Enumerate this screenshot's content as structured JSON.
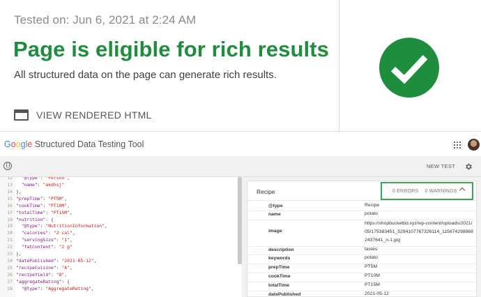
{
  "rich_results": {
    "tested_on": "Tested on: Jun 6, 2021 at 2:24 AM",
    "title": "Page is eligible for rich results",
    "subtitle": "All structured data on the page can generate rich results.",
    "view_rendered_html": "VIEW RENDERED HTML",
    "status_color": "#1e8e3e",
    "status_icon": "check-circle-icon"
  },
  "tool": {
    "google": [
      "G",
      "o",
      "o",
      "g",
      "l",
      "e"
    ],
    "name": "Structured Data Testing Tool",
    "new_test": "NEW TEST"
  },
  "code_lines": [
    {
      "n": "12",
      "t": [
        [
          "p",
          "  \""
        ],
        [
          "k",
          "@type"
        ],
        [
          "p",
          "\": "
        ],
        [
          "s",
          "\"Person\""
        ],
        [
          "p",
          ","
        ]
      ]
    },
    {
      "n": "13",
      "t": [
        [
          "p",
          "  \""
        ],
        [
          "k",
          "name"
        ],
        [
          "p",
          "\": "
        ],
        [
          "s",
          "\"akdhsj\""
        ]
      ]
    },
    {
      "n": "14",
      "t": [
        [
          "p",
          "},"
        ]
      ]
    },
    {
      "n": "15",
      "t": [
        [
          "p",
          "\""
        ],
        [
          "k",
          "prepTime"
        ],
        [
          "p",
          "\": "
        ],
        [
          "s",
          "\"PT5M\""
        ],
        [
          "p",
          ","
        ]
      ]
    },
    {
      "n": "16",
      "t": [
        [
          "p",
          "\""
        ],
        [
          "k",
          "cookTime"
        ],
        [
          "p",
          "\": "
        ],
        [
          "s",
          "\"PT10M\""
        ],
        [
          "p",
          ","
        ]
      ]
    },
    {
      "n": "17",
      "t": [
        [
          "p",
          "\""
        ],
        [
          "k",
          "totalTime"
        ],
        [
          "p",
          "\": "
        ],
        [
          "s",
          "\"PT15M\""
        ],
        [
          "p",
          ","
        ]
      ]
    },
    {
      "n": "18",
      "t": [
        [
          "p",
          "\""
        ],
        [
          "k",
          "nutrition"
        ],
        [
          "p",
          "\": {"
        ]
      ]
    },
    {
      "n": "19",
      "t": [
        [
          "p",
          "  \""
        ],
        [
          "k",
          "@type"
        ],
        [
          "p",
          "\": "
        ],
        [
          "s",
          "\"NutritionInformation\""
        ],
        [
          "p",
          ","
        ]
      ]
    },
    {
      "n": "20",
      "t": [
        [
          "p",
          "  \""
        ],
        [
          "k",
          "calories"
        ],
        [
          "p",
          "\": "
        ],
        [
          "s",
          "\"2 cal\""
        ],
        [
          "p",
          ","
        ]
      ]
    },
    {
      "n": "21",
      "t": [
        [
          "p",
          "  \""
        ],
        [
          "k",
          "servingSize"
        ],
        [
          "p",
          "\": "
        ],
        [
          "s",
          "\"1\""
        ],
        [
          "p",
          ","
        ]
      ]
    },
    {
      "n": "22",
      "t": [
        [
          "p",
          "  \""
        ],
        [
          "k",
          "fatContent"
        ],
        [
          "p",
          "\": "
        ],
        [
          "s",
          "\"2 g\""
        ]
      ]
    },
    {
      "n": "23",
      "t": [
        [
          "p",
          "},"
        ]
      ]
    },
    {
      "n": "24",
      "t": [
        [
          "p",
          "\""
        ],
        [
          "k",
          "datePublished"
        ],
        [
          "p",
          "\": "
        ],
        [
          "s",
          "\"2021-05-12\""
        ],
        [
          "p",
          ","
        ]
      ]
    },
    {
      "n": "25",
      "t": [
        [
          "p",
          "\""
        ],
        [
          "k",
          "recipeCuisine"
        ],
        [
          "p",
          "\": "
        ],
        [
          "s",
          "\"A\""
        ],
        [
          "p",
          ","
        ]
      ]
    },
    {
      "n": "26",
      "t": [
        [
          "p",
          "\""
        ],
        [
          "k",
          "recipeYield"
        ],
        [
          "p",
          "\": "
        ],
        [
          "s",
          "\"8\""
        ],
        [
          "p",
          ","
        ]
      ]
    },
    {
      "n": "27",
      "t": [
        [
          "p",
          "\""
        ],
        [
          "k",
          "aggregateRating"
        ],
        [
          "p",
          "\": {"
        ]
      ]
    },
    {
      "n": "28",
      "t": [
        [
          "p",
          "  \""
        ],
        [
          "k",
          "@type"
        ],
        [
          "p",
          "\": "
        ],
        [
          "s",
          "\"AggregateRating\""
        ],
        [
          "p",
          ","
        ]
      ]
    }
  ],
  "results": {
    "item_type": "Recipe",
    "errors": "0 ERRORS",
    "warnings": "0 WARNINGS",
    "rows": [
      {
        "key": "@type",
        "val": "Recipe"
      },
      {
        "key": "name",
        "val": "potato"
      },
      {
        "key": "image",
        "val": "https://shopbucketbd.xyz/wp-content/uploads/2021/05/175383451_5294107767326114_1156742988682437641_n-1.jpg"
      },
      {
        "key": "description",
        "val": "tastes"
      },
      {
        "key": "keywords",
        "val": "potato"
      },
      {
        "key": "prepTime",
        "val": "PT5M"
      },
      {
        "key": "cookTime",
        "val": "PT10M"
      },
      {
        "key": "totalTime",
        "val": "PT15M"
      },
      {
        "key": "datePublished",
        "val": "2021-05-12"
      }
    ]
  }
}
